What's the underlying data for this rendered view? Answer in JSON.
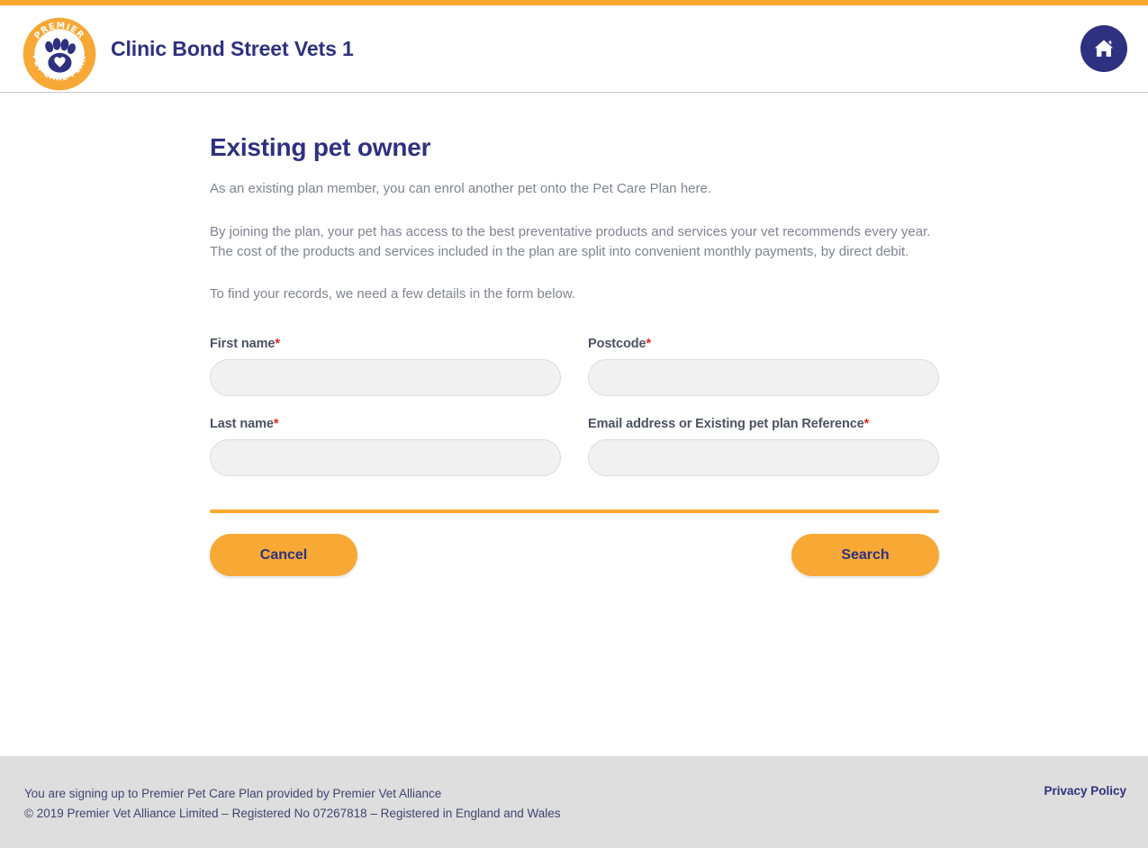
{
  "theme": {
    "accent_orange": "#fca82f",
    "brand_navy": "#2e3180",
    "required_red": "#e02020",
    "field_bg": "#f1f1f1",
    "footer_bg": "#dedede"
  },
  "header": {
    "clinic_title": "Clinic Bond Street Vets 1",
    "logo": {
      "top_arc_text": "PREMIER",
      "bottom_arc_text": "PET CARE PLAN",
      "icon": "paw-print-with-heart"
    },
    "home_button_icon": "home-icon"
  },
  "main": {
    "page_title": "Existing pet owner",
    "paragraph_1": "As an existing plan member, you can enrol another pet onto the Pet Care Plan here.",
    "paragraph_2": "By joining the plan, your pet has access to the best preventative products and services your vet recommends every year. The cost of the products and services included in the plan are split into convenient monthly payments, by direct debit.",
    "paragraph_3": "To find your records, we need a few details in the form below.",
    "required_marker": "*",
    "fields": [
      {
        "id": "first_name",
        "label": "First name",
        "required": true,
        "value": "",
        "placeholder": ""
      },
      {
        "id": "postcode",
        "label": "Postcode",
        "required": true,
        "value": "",
        "placeholder": ""
      },
      {
        "id": "last_name",
        "label": "Last name",
        "required": true,
        "value": "",
        "placeholder": ""
      },
      {
        "id": "email_or_reference",
        "label": "Email address or Existing pet plan Reference",
        "required": true,
        "value": "",
        "placeholder": ""
      }
    ],
    "buttons": {
      "cancel": "Cancel",
      "search": "Search"
    }
  },
  "footer": {
    "line_1": "You are signing up to Premier Pet Care Plan provided by Premier Vet Alliance",
    "line_2": "© 2019 Premier Vet Alliance Limited – Registered No 07267818 – Registered in England and Wales",
    "privacy_link": "Privacy Policy"
  }
}
